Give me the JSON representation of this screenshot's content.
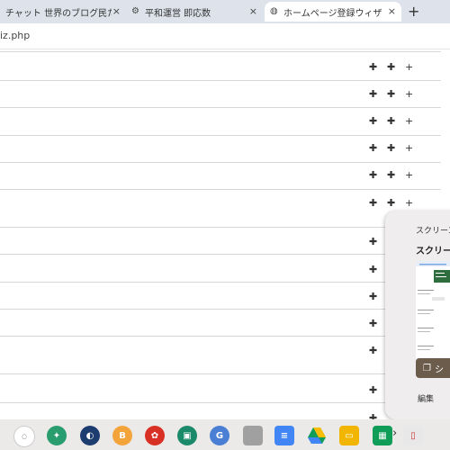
{
  "tabs": [
    {
      "label": "チャット 世界のブログ民たち",
      "close": "×"
    },
    {
      "label": "平和運営 即応数",
      "close": "×"
    },
    {
      "label": "ホームページ登録ウィザー",
      "close": "×"
    }
  ],
  "new_tab": "+",
  "address": {
    "url": "iz.php"
  },
  "row_controls": {
    "a": "✚",
    "b": "✚",
    "c": "+"
  },
  "popup": {
    "title": "スクリーン",
    "heading": "スクリーン",
    "button_label": "シ",
    "footer_label": "編集"
  },
  "taskbar": {
    "chevron": "›",
    "apps": [
      {
        "name": "app-1"
      },
      {
        "name": "app-2"
      },
      {
        "name": "app-3"
      },
      {
        "name": "app-4"
      },
      {
        "name": "app-5"
      },
      {
        "name": "app-6"
      },
      {
        "name": "app-7"
      },
      {
        "name": "app-8"
      },
      {
        "name": "app-9"
      },
      {
        "name": "app-10"
      },
      {
        "name": "app-11"
      },
      {
        "name": "app-12"
      },
      {
        "name": "app-13"
      }
    ]
  }
}
